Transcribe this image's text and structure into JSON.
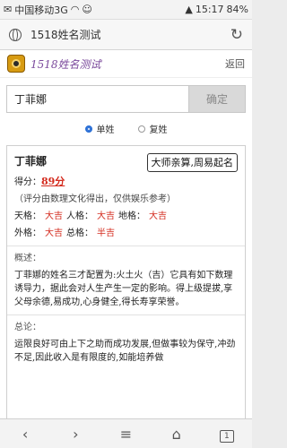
{
  "status": {
    "carrier": "中国移动3G",
    "time": "15:17",
    "battery": "84%"
  },
  "browser": {
    "url": "1518姓名测试"
  },
  "header": {
    "site_title": "1518姓名测试",
    "back": "返回"
  },
  "search": {
    "value": "丁菲娜",
    "button": "确定"
  },
  "surname_options": [
    {
      "label": "单姓",
      "selected": true
    },
    {
      "label": "复姓",
      "selected": false
    }
  ],
  "result": {
    "name": "丁菲娜",
    "master_button": "大师亲算,周易起名",
    "score_label": "得分：",
    "score_value": "89分",
    "note": "（评分由数理文化得出，仅供娱乐参考）",
    "grid_row1": [
      {
        "label": "天格：",
        "value": "大吉"
      },
      {
        "label": "人格：",
        "value": "大吉"
      },
      {
        "label": "地格：",
        "value": "大吉"
      }
    ],
    "grid_row2": [
      {
        "label": "外格：",
        "value": "大吉"
      },
      {
        "label": "总格：",
        "value": "半吉"
      }
    ],
    "overview_title": "概述：",
    "overview_text": "丁菲娜的姓名三才配置为:火土火（吉）它具有如下数理诱导力，据此会对人生产生一定的影响。得上级提拔,享父母余德,易成功,心身健全,得长寿享荣誉。",
    "summary_title": "总论：",
    "summary_text": "运限良好可由上下之助而成功发展,但做事较为保守,冲劲不足,因此收入是有限度的,如能培养做"
  },
  "colors": {
    "accent_red": "#d42b1e",
    "brand_purple": "#7b4a9c",
    "radio_blue": "#2a6fd6"
  },
  "nav": {
    "tab_count": "1"
  }
}
